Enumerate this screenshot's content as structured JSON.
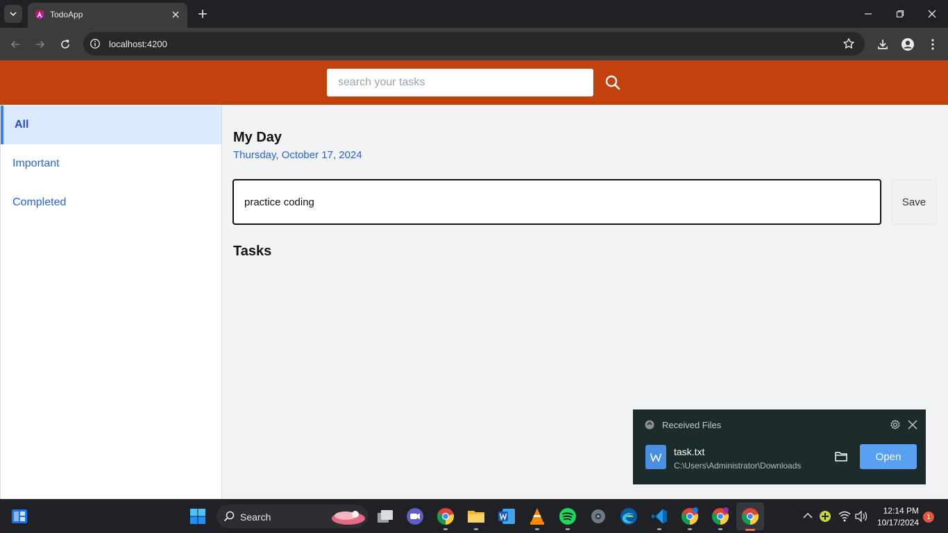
{
  "browser": {
    "tab_title": "TodoApp",
    "url": "localhost:4200"
  },
  "app": {
    "search": {
      "placeholder": "search your tasks",
      "value": ""
    },
    "sidebar": {
      "items": [
        {
          "label": "All",
          "active": true
        },
        {
          "label": "Important",
          "active": false
        },
        {
          "label": "Completed",
          "active": false
        }
      ]
    },
    "main": {
      "title": "My Day",
      "date": "Thursday, October 17, 2024",
      "task_input_value": "practice coding",
      "save_label": "Save",
      "tasks_heading": "Tasks"
    },
    "colors": {
      "header": "#c2410c",
      "accent": "#2563eb",
      "active_bg": "#dbeafe"
    }
  },
  "notification": {
    "app_name": "Received Files",
    "file_name": "task.txt",
    "file_path": "C:\\Users\\Administrator\\Downloads",
    "open_label": "Open"
  },
  "taskbar": {
    "search_label": "Search",
    "time": "12:14 PM",
    "date": "10/17/2024",
    "notification_count": "1",
    "pinned_icons": [
      "widgets-icon",
      "start-icon",
      "search-icon",
      "task-view-icon",
      "meet-icon",
      "chrome-icon",
      "file-explorer-icon",
      "word-icon",
      "vlc-icon",
      "spotify-icon",
      "settings-icon",
      "edge-icon",
      "vscode-icon",
      "chrome-profile-icon",
      "chrome-profile-icon",
      "chrome-icon"
    ]
  }
}
